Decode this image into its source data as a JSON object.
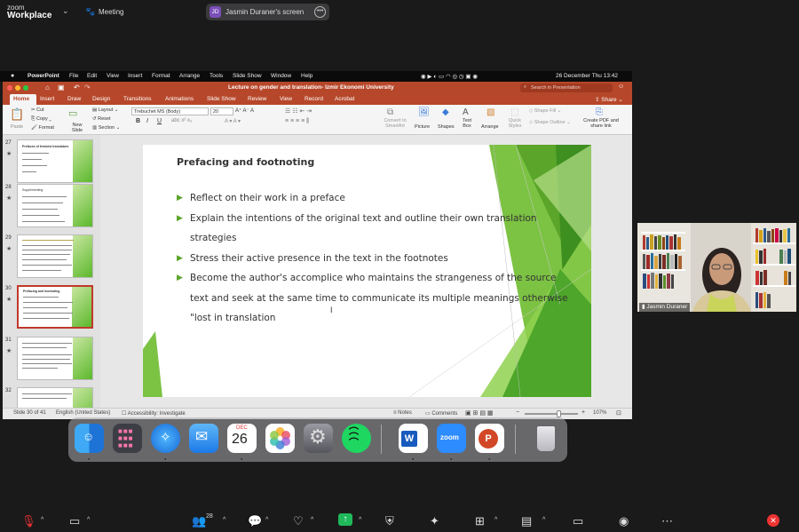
{
  "zoom": {
    "brand_top": "zoom",
    "brand_bottom": "Workplace",
    "meeting_label": "Meeting",
    "share_initials": "JD",
    "share_label": "Jasmin Duraner's screen",
    "participant_count": "28",
    "video_name": "Jasmin Duraner"
  },
  "mac_menu": {
    "app": "PowerPoint",
    "items": [
      "File",
      "Edit",
      "View",
      "Insert",
      "Format",
      "Arrange",
      "Tools",
      "Slide Show",
      "Window",
      "Help"
    ],
    "clock": "26 December Thu  13:42"
  },
  "ppt": {
    "doc_title": "Lecture on gender and translation- Izmir Ekonomi University",
    "search_placeholder": "Search in Presentation",
    "share_label": "Share",
    "tabs": [
      "Home",
      "Insert",
      "Draw",
      "Design",
      "Transitions",
      "Animations",
      "Slide Show",
      "Review",
      "View",
      "Record",
      "Acrobat"
    ],
    "ribbon": {
      "paste": "Paste",
      "cut": "Cut",
      "copy": "Copy",
      "format": "Format",
      "new_slide": "New Slide",
      "layout": "Layout",
      "reset": "Reset",
      "section": "Section",
      "font_name": "Trebuchet MS (Body)",
      "font_size": "20",
      "convert": "Convert to SmartArt",
      "picture": "Picture",
      "shapes": "Shapes",
      "text_box": "Text Box",
      "arrange": "Arrange",
      "quick_styles": "Quick Styles",
      "shape_fill": "Shape Fill",
      "shape_outline": "Shape Outline",
      "create_pdf": "Create PDF and share link"
    },
    "thumbs": [
      {
        "num": "27",
        "title": "Prefaces of feminist translators"
      },
      {
        "num": "28",
        "title": "Supplementing"
      },
      {
        "num": "29",
        "title": ""
      },
      {
        "num": "30",
        "title": "Prefacing and footnoting"
      },
      {
        "num": "31",
        "title": ""
      },
      {
        "num": "32",
        "title": ""
      }
    ],
    "slide": {
      "title": "Prefacing and footnoting",
      "bullets": [
        "Reflect on their work in a preface",
        "Explain the intentions of the original text and outline their own translation strategies",
        "Stress their active presence in the text in the footnotes",
        "Become the author's accomplice who maintains the strangeness of the source text and  seek at the same time to communicate its multiple meanings otherwise \"lost in translation"
      ]
    },
    "status": {
      "slide_pos": "Slide 30 of 41",
      "language": "English (United States)",
      "accessibility": "Accessibility: Investigate",
      "notes": "Notes",
      "comments": "Comments",
      "zoom_pct": "107%"
    }
  },
  "dock": {
    "calendar_month": "DEC",
    "calendar_day": "26",
    "zoom_label": "zoom"
  }
}
